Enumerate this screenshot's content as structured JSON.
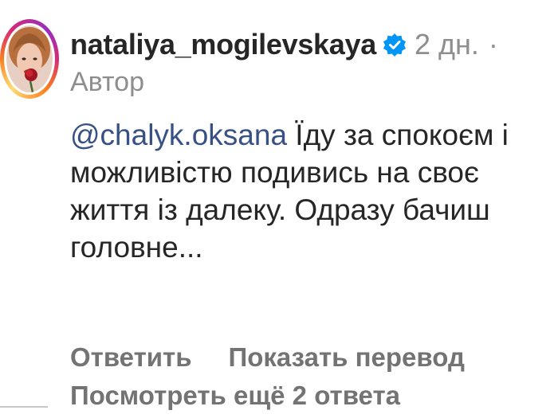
{
  "comment": {
    "username": "nataliya_mogilevskaya",
    "verified_icon": "verified-badge-icon",
    "time": "2 дн.",
    "separator": "·",
    "author_label": "Автор",
    "mention": "@chalyk.oksana",
    "text": " Їду за спокоєм і можливістю подивись на своє життя із далеку. Одразу бачиш головне..."
  },
  "actions": {
    "reply": "Ответить",
    "show_translation": "Показать перевод"
  },
  "replies": {
    "view_more": "Посмотреть ещё 2 ответа"
  },
  "colors": {
    "text": "#262626",
    "secondary": "#8e8e8e",
    "link": "#385185",
    "verified": "#0095f6"
  }
}
